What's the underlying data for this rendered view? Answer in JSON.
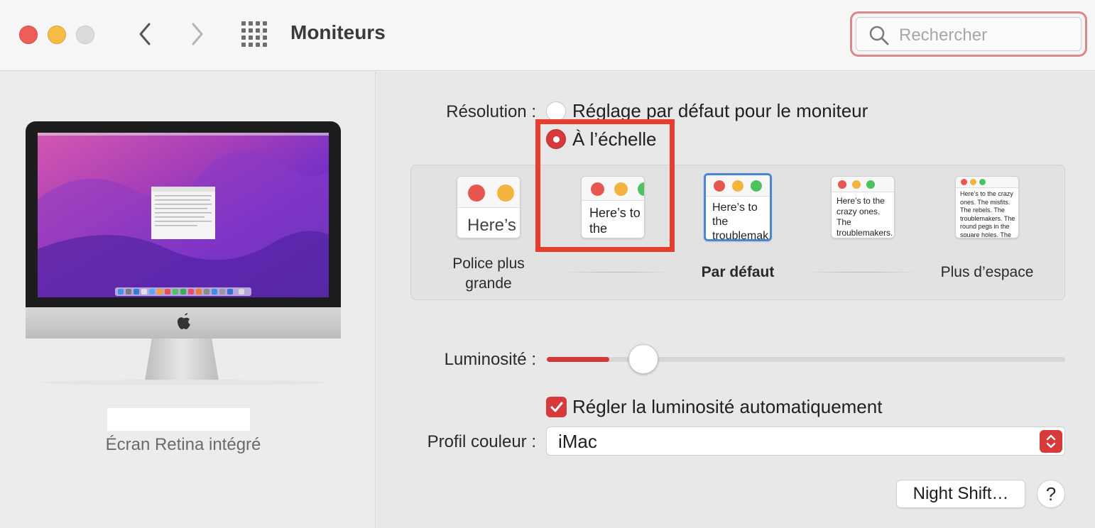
{
  "window": {
    "title": "Moniteurs"
  },
  "search": {
    "placeholder": "Rechercher"
  },
  "icons": {
    "back": "chevron-left-icon",
    "forward": "chevron-right-icon",
    "grid": "grid-icon",
    "search": "magnifier-icon"
  },
  "display": {
    "caption": "Écran Retina intégré"
  },
  "resolution": {
    "label": "Résolution :",
    "options": [
      {
        "label": "Réglage par défaut pour le moniteur",
        "selected": false
      },
      {
        "label": "À l’échelle",
        "selected": true
      }
    ]
  },
  "scaling": {
    "thumbs": [
      {
        "text": "Here’s"
      },
      {
        "text": "Here’s to the troublemakers."
      },
      {
        "text": "Here’s to the troublemakers. The round pegs in the square holes. The ones who",
        "selected": true
      },
      {
        "text": "Here’s to the crazy ones. The troublemakers. The round pegs. The ones who see things differently. They're not fond of rules. And they"
      },
      {
        "text": "Here’s to the crazy ones. The misfits. The rebels. The troublemakers. The round pegs in the square holes. The ones who see things differently. They're not fond of rules. And they have no respect for the status quo. You can quote them, disagree with them, glorify or vilify them. About the only thing you can't do is ignore them. Because they change things."
      }
    ],
    "label_larger": "Police plus grande",
    "label_default": "Par défaut",
    "label_more_space": "Plus d’espace"
  },
  "brightness": {
    "label": "Luminosité :",
    "level": 0.12
  },
  "auto_brightness": {
    "label": "Régler la luminosité automatiquement",
    "checked": true
  },
  "color_profile": {
    "label": "Profil couleur :",
    "value": "iMac"
  },
  "buttons": {
    "night_shift": "Night Shift…",
    "help": "?"
  },
  "colors": {
    "accent": "#d63a3a",
    "highlight_box": "#e53e2f",
    "selected_thumb": "#4a86d8"
  }
}
